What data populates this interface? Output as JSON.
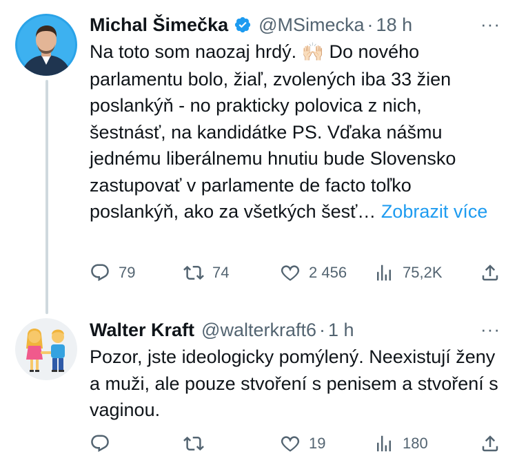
{
  "tweets": [
    {
      "author_name": "Michal Šimečka",
      "verified": true,
      "handle": "@MSimecka",
      "separator": "·",
      "time": "18 h",
      "more": "···",
      "text_before_emoji": "Na toto som naozaj hrdý. ",
      "emoji": "🙌🏻",
      "text_after_emoji": " Do nového parlamentu bolo, žiaľ, zvolených iba 33 žien poslankýň - no prakticky polovica z nich, šestnásť, na kandidátke PS. Vďaka nášmu jednému liberálnemu hnutiu bude Slovensko zastupovať v parlamente de facto toľko poslankýň, ako za všetkých šesť… ",
      "show_more": "Zobrazit více",
      "replies": "79",
      "retweets": "74",
      "likes": "2 456",
      "views": "75,2K"
    },
    {
      "author_name": "Walter Kraft",
      "handle": "@walterkraft6",
      "separator": "·",
      "time": "1 h",
      "more": "···",
      "text": "Pozor, jste ideologicky pomýlený. Neexistují ženy a muži, ale pouze stvoření s penisem a stvoření s vaginou.",
      "replies": "",
      "retweets": "",
      "likes": "19",
      "views": "180"
    }
  ],
  "colors": {
    "text": "#0f1419",
    "secondary": "#536471",
    "link": "#1d9bf0",
    "verified": "#1d9bf0",
    "thread_line": "#cfd9de"
  }
}
